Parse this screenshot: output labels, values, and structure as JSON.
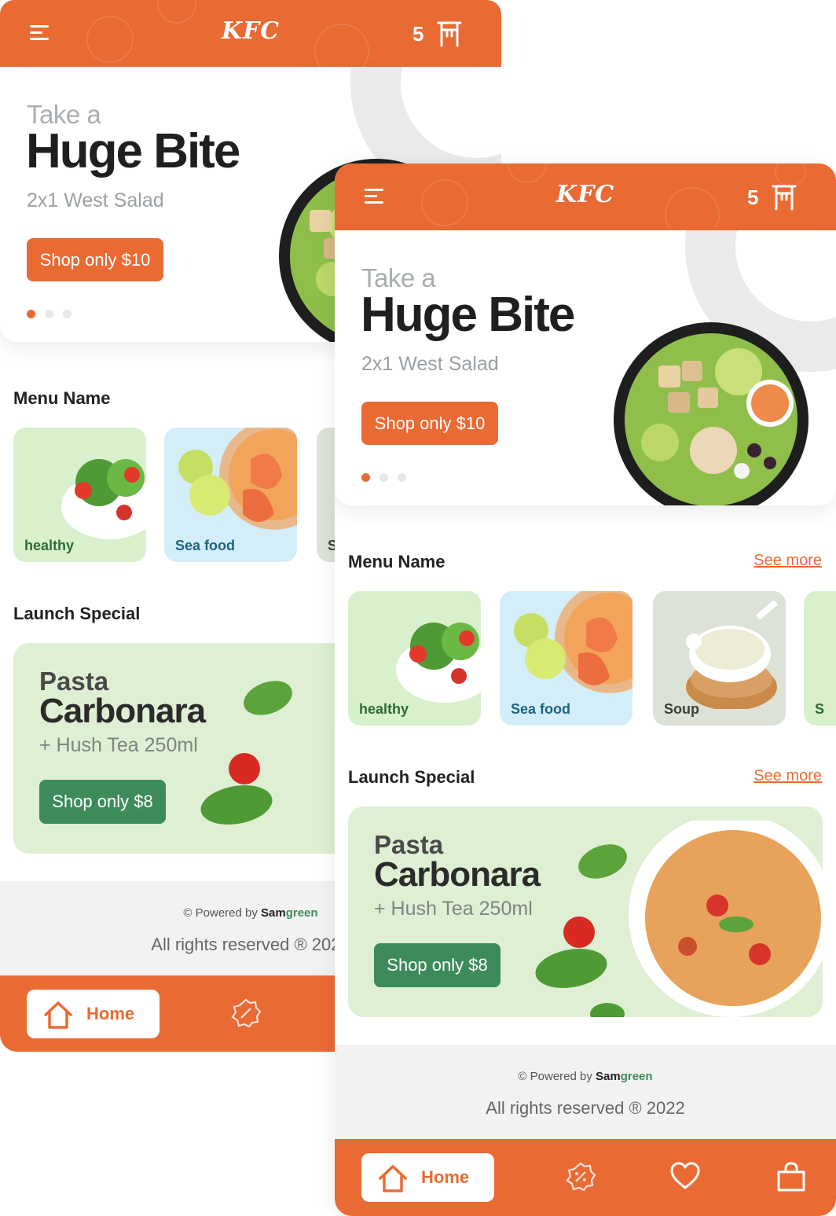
{
  "header": {
    "brand": "KFC",
    "cart_count": "5"
  },
  "hero": {
    "pretitle": "Take a",
    "title": "Huge Bite",
    "subtitle": "2x1 West Salad",
    "cta": "Shop only $10",
    "slides": 3,
    "active_slide": 1
  },
  "menu": {
    "title": "Menu Name",
    "see_more": "See more",
    "categories": [
      {
        "label": "healthy",
        "bg": "#d8f0cc",
        "color": "#2f6b3a"
      },
      {
        "label": "Sea food",
        "bg": "#d4eef9",
        "color": "#1d6482"
      },
      {
        "label": "Soup",
        "bg": "#dde2d7",
        "color": "#3b4039"
      },
      {
        "label": "S",
        "bg": "#d8f0cc",
        "color": "#2f6b3a"
      }
    ]
  },
  "launch": {
    "title": "Launch Special",
    "see_more": "See more",
    "promo": {
      "pretitle": "Pasta",
      "title": "Carbonara",
      "subtitle": "+ Hush Tea 250ml",
      "cta": "Shop only $8"
    }
  },
  "footer": {
    "powered_prefix": "© Powered by",
    "powered_brand_a": "Sam",
    "powered_brand_b": "green",
    "rights": "All rights reserved ® 2022"
  },
  "nav": {
    "home": "Home"
  },
  "colors": {
    "accent": "#ea6a34",
    "promo_green": "#3d8a5b",
    "promo_bg": "#dfefd3"
  }
}
